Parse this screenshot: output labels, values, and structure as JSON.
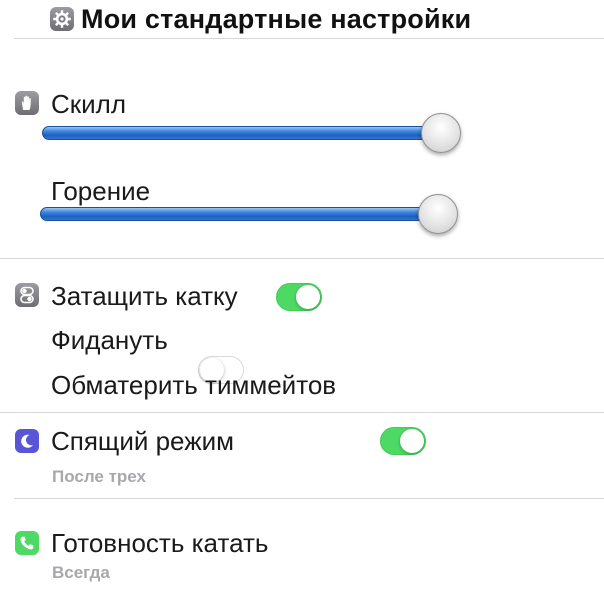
{
  "header": {
    "title": "Мои стандартные настройки",
    "icon": "gear-icon"
  },
  "sliders": {
    "icon": "hand-icon",
    "items": [
      {
        "label": "Скилл",
        "value_fraction": 0.89
      },
      {
        "label": "Горение",
        "value_fraction": 0.91
      }
    ]
  },
  "toggles": {
    "icon": "switches-icon",
    "items": [
      {
        "label": "Затащить катку",
        "on": true
      },
      {
        "label": "Фидануть",
        "on": false
      },
      {
        "label": "Обматерить тиммейтов",
        "on": true
      }
    ]
  },
  "sleep": {
    "icon": "moon-icon",
    "icon_color": "#5856d6",
    "label": "Спящий режим",
    "value": "После трех"
  },
  "readiness": {
    "icon": "phone-icon",
    "icon_color": "#4cd964",
    "label": "Готовность катать",
    "value": "Всегда"
  },
  "colors": {
    "toggle_on": "#4cd964",
    "slider_fill": "#2f6fce",
    "divider": "#d6d6d8",
    "sublabel": "#a8a8ac"
  }
}
